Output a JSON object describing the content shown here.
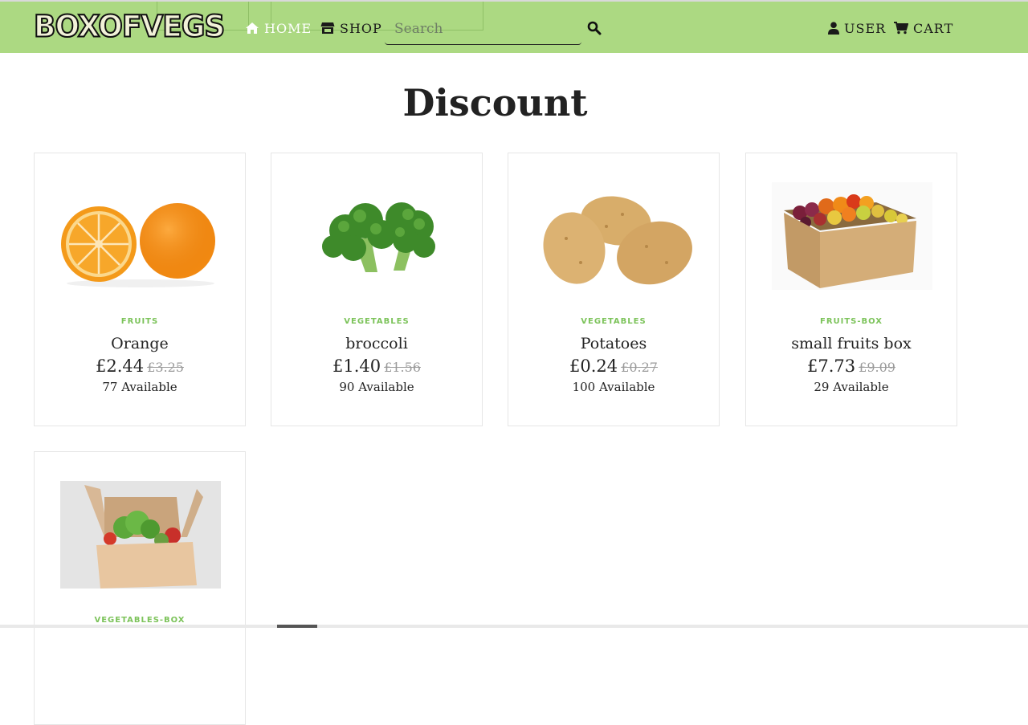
{
  "header": {
    "logo_text": "BOXOFVEGS",
    "nav": {
      "home_label": "HOME",
      "home_icon": "home-icon",
      "shop_label": "SHOP",
      "shop_icon": "store-icon",
      "user_label": "USER",
      "user_icon": "user-icon",
      "cart_label": "CART",
      "cart_icon": "cart-icon"
    },
    "search": {
      "placeholder": "Search",
      "value": "",
      "icon": "search-icon"
    },
    "colors": {
      "bar": "#acd982",
      "accent": "#7cc35a"
    }
  },
  "main": {
    "title": "Discount",
    "products": [
      {
        "category": "FRUITS",
        "name": "Orange",
        "price": "£2.44",
        "old_price": "£3.25",
        "stock": "77 Available",
        "image": "orange-image"
      },
      {
        "category": "VEGETABLES",
        "name": "broccoli",
        "price": "£1.40",
        "old_price": "£1.56",
        "stock": "90 Available",
        "image": "broccoli-image"
      },
      {
        "category": "VEGETABLES",
        "name": "Potatoes",
        "price": "£0.24",
        "old_price": "£0.27",
        "stock": "100 Available",
        "image": "potatoes-image"
      },
      {
        "category": "FRUITS-BOX",
        "name": "small fruits box",
        "price": "£7.73",
        "old_price": "£9.09",
        "stock": "29 Available",
        "image": "fruit-box-image"
      },
      {
        "category": "VEGETABLES-BOX",
        "name": "",
        "price": "",
        "old_price": "",
        "stock": "",
        "image": "vegetable-box-image"
      }
    ]
  }
}
